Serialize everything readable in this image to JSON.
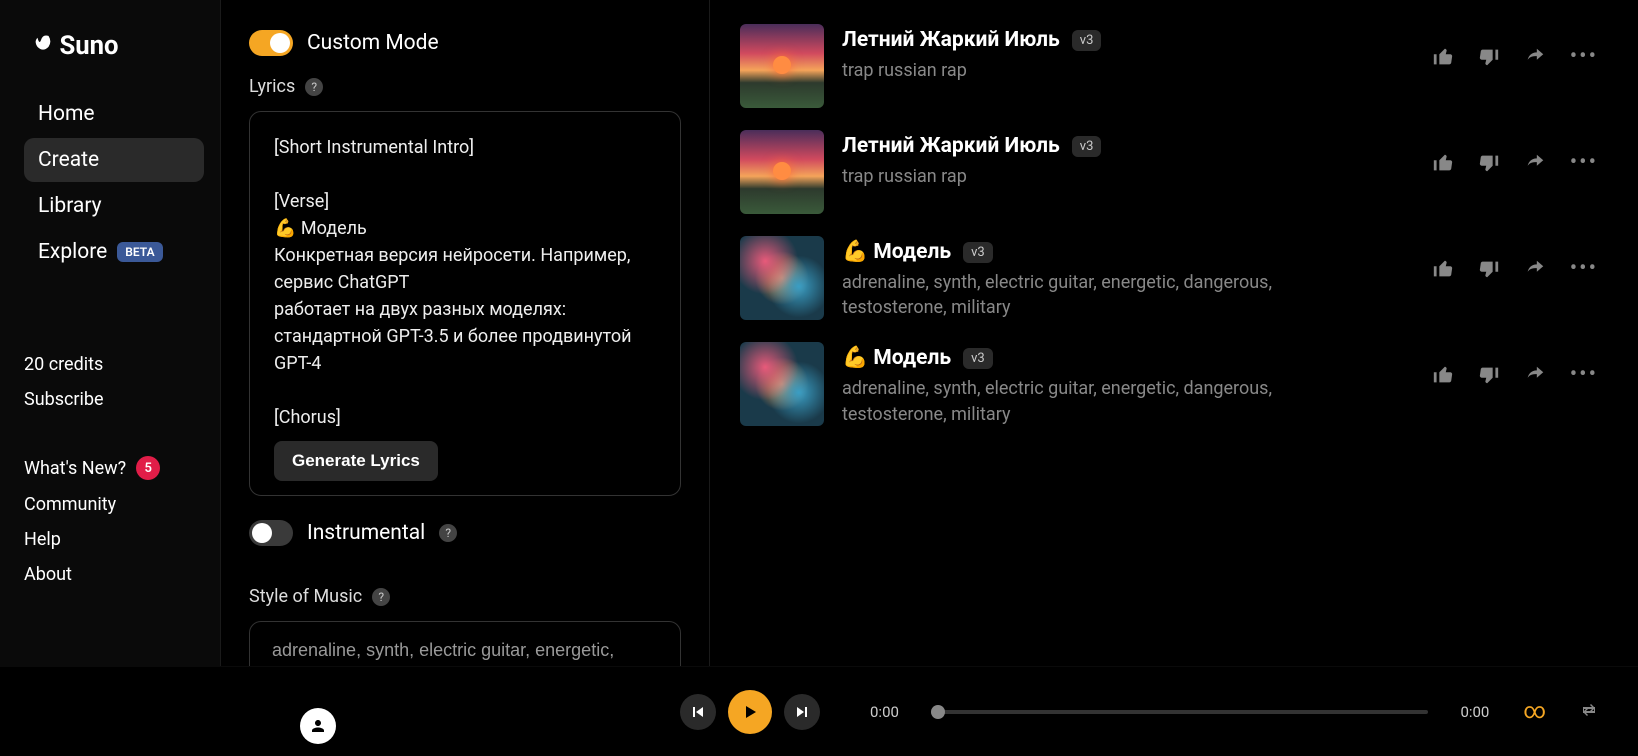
{
  "brand": "Suno",
  "sidebar": {
    "nav": [
      {
        "label": "Home",
        "active": false
      },
      {
        "label": "Create",
        "active": true
      },
      {
        "label": "Library",
        "active": false
      },
      {
        "label": "Explore",
        "active": false,
        "beta": "BETA"
      }
    ],
    "credits": "20 credits",
    "subscribe": "Subscribe",
    "whatsnew": "What's New?",
    "whatsnew_count": "5",
    "community": "Community",
    "help": "Help",
    "about": "About"
  },
  "editor": {
    "custom_mode_label": "Custom Mode",
    "custom_mode_on": true,
    "lyrics_label": "Lyrics",
    "lyrics_text": "[Short Instrumental Intro]\n\n[Verse]\n💪 Модель\nКонкретная версия нейросети. Например, сервис ChatGPT\nработает на двух разных моделях: стандартной GPT-3.5 и более продвинутой GPT-4\n\n[Chorus]",
    "generate_lyrics": "Generate Lyrics",
    "instrumental_label": "Instrumental",
    "instrumental_on": false,
    "style_label": "Style of Music",
    "style_value": "adrenaline, synth, electric guitar, energetic,"
  },
  "tracks": [
    {
      "title": "Летний Жаркий Июль",
      "version": "v3",
      "tags": "trap russian rap",
      "thumb": "sunset"
    },
    {
      "title": "Летний Жаркий Июль",
      "version": "v3",
      "tags": "trap russian rap",
      "thumb": "sunset"
    },
    {
      "title": "💪 Модель",
      "version": "v3",
      "tags": "adrenaline, synth, electric guitar, energetic, dangerous, testosterone, military",
      "thumb": "abstract"
    },
    {
      "title": "💪 Модель",
      "version": "v3",
      "tags": "adrenaline, synth, electric guitar, energetic, dangerous, testosterone, military",
      "thumb": "abstract"
    }
  ],
  "player": {
    "current": "0:00",
    "total": "0:00"
  }
}
